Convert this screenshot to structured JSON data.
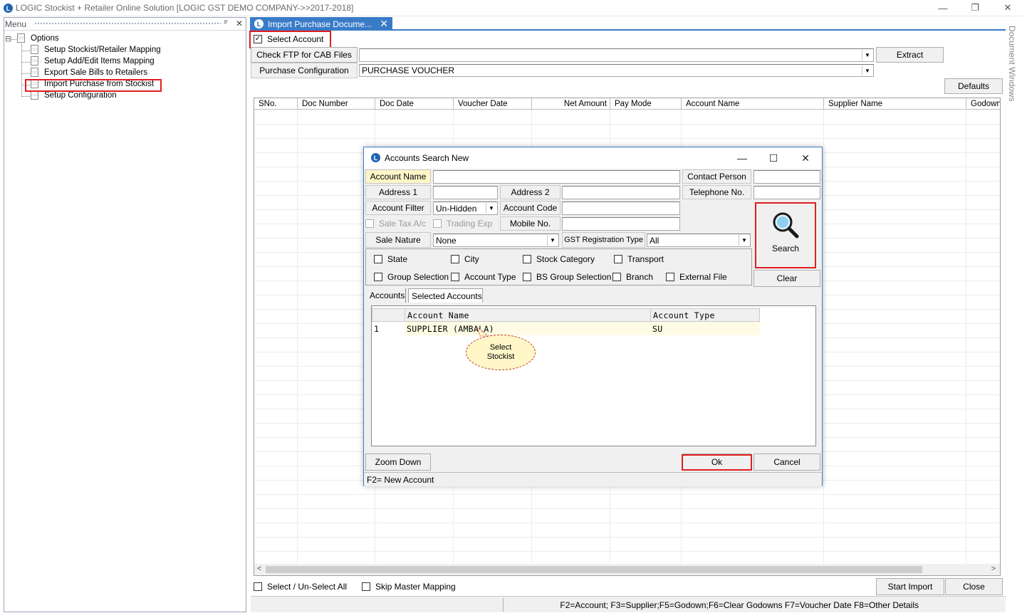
{
  "window": {
    "title": "LOGIC Stockist + Retailer Online Solution [LOGIC GST DEMO COMPANY->>2017-2018]",
    "controls": {
      "minimize": "—",
      "restore": "❐",
      "close": "✕"
    }
  },
  "menu": {
    "title": "Menu",
    "pin": "ᵖ",
    "close": "✕",
    "root": {
      "expander": "⊟",
      "label": "Options"
    },
    "items": [
      {
        "label": "Setup Stockist/Retailer Mapping"
      },
      {
        "label": "Setup Add/Edit Items Mapping"
      },
      {
        "label": "Export Sale Bills to Retailers"
      },
      {
        "label": "Import Purchase from Stockist"
      },
      {
        "label": "Setup Configuration"
      }
    ]
  },
  "document": {
    "tab_label": "Import Purchase Docume...",
    "tab_close": "✕",
    "select_account_label": "Select Account",
    "select_account_checked": "✓",
    "check_ftp_button": "Check FTP for CAB Files",
    "ftp_value": "",
    "extract_button": "Extract",
    "purchase_config_label": "Purchase Configuration",
    "purchase_config_value": "PURCHASE VOUCHER",
    "defaults_button": "Defaults",
    "dropdown_arrow": "▼",
    "columns": [
      "SNo.",
      "Doc Number",
      "Doc Date",
      "Voucher Date",
      "Net Amount",
      "Pay Mode",
      "Account Name",
      "Supplier Name",
      "Godown"
    ],
    "scroll_left": "<",
    "scroll_right": ">",
    "select_unselect_all_label": "Select / Un-Select All",
    "skip_master_mapping_label": "Skip Master Mapping",
    "start_import_button": "Start Import",
    "close_button": "Close",
    "status_text": "F2=Account; F3=Supplier;F5=Godown;F6=Clear Godowns F7=Voucher Date F8=Other Details",
    "side_panel_label": "Document Windows"
  },
  "dialog": {
    "title": "Accounts Search New",
    "controls": {
      "minimize": "—",
      "maximize": "☐",
      "close": "✕"
    },
    "fields": {
      "account_name_label": "Account Name",
      "account_name_value": "",
      "contact_person_label": "Contact Person",
      "contact_person_value": "",
      "address1_label": "Address 1",
      "address1_value": "",
      "address2_label": "Address 2",
      "address2_value": "",
      "telephone_label": "Telephone No.",
      "telephone_value": "",
      "account_filter_label": "Account Filter",
      "account_filter_value": "Un-Hidden",
      "account_code_label": "Account Code",
      "account_code_value": "",
      "sale_tax_label": "Sale Tax A/c",
      "trading_exp_label": "Trading Exp",
      "mobile_label": "Mobile No.",
      "mobile_value": "",
      "sale_nature_label": "Sale Nature",
      "sale_nature_value": "None",
      "gst_reg_label": "GST Registration Type",
      "gst_reg_value": "All"
    },
    "filters": [
      "State",
      "City",
      "Stock Category",
      "Transport",
      "Group Selection",
      "Account Type",
      "BS Group Selection",
      "Branch",
      "External File"
    ],
    "search_button": "Search",
    "clear_button": "Clear",
    "tabs": [
      "Accounts",
      "Selected Accounts"
    ],
    "grid_columns": [
      "Account Name",
      "Account Type"
    ],
    "rows": [
      {
        "sno": "1",
        "account_name": "SUPPLIER (AMBALA)",
        "account_type": "SU"
      }
    ],
    "zoom_down_button": "Zoom Down",
    "ok_button": "Ok",
    "cancel_button": "Cancel",
    "status_text": "F2= New Account"
  },
  "callout": {
    "line1": "Select",
    "line2": "Stockist"
  },
  "colors": {
    "accent": "#3a7bc8",
    "highlight_border": "#e01e1e",
    "label_yellow": "#fff6c8"
  }
}
